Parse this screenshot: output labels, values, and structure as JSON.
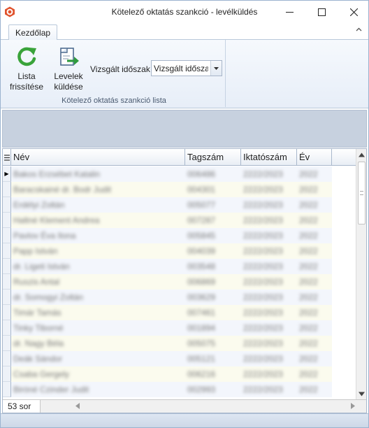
{
  "window": {
    "title": "Kötelező oktatás szankció - levélküldés"
  },
  "ribbon": {
    "tabs": [
      {
        "label": "Kezdőlap",
        "active": true
      }
    ],
    "buttons": {
      "refresh": {
        "line1": "Lista",
        "line2": "frissítése",
        "icon": "refresh-icon"
      },
      "send": {
        "line1": "Levelek",
        "line2": "küldése",
        "icon": "send-letters-icon"
      }
    },
    "period": {
      "label": "Vizsgált időszak",
      "value": "Vizsgált időszak"
    },
    "group_caption": "Kötelező oktatás szankció lista"
  },
  "grid": {
    "columns": [
      "Név",
      "Tagszám",
      "Iktatószám",
      "Év"
    ],
    "rows": [
      {
        "nev": "Bakos Erzsébet Katalin",
        "tagszam": "006486",
        "iktato": "2222/2023",
        "ev": "2022"
      },
      {
        "nev": "Baracskainé dr. Bodr Judit",
        "tagszam": "004301",
        "iktato": "2222/2023",
        "ev": "2022"
      },
      {
        "nev": "Erdélyi Zoltán",
        "tagszam": "005077",
        "iktato": "2222/2023",
        "ev": "2022"
      },
      {
        "nev": "Haltné Klement Andrea",
        "tagszam": "007287",
        "iktato": "2222/2023",
        "ev": "2022"
      },
      {
        "nev": "Pavlov Éva Ilona",
        "tagszam": "005845",
        "iktato": "2222/2023",
        "ev": "2022"
      },
      {
        "nev": "Papp István",
        "tagszam": "004039",
        "iktato": "2222/2023",
        "ev": "2022"
      },
      {
        "nev": "dr. Ligeti István",
        "tagszam": "003548",
        "iktato": "2222/2023",
        "ev": "2022"
      },
      {
        "nev": "Ruszis Antal",
        "tagszam": "006869",
        "iktato": "2222/2023",
        "ev": "2022"
      },
      {
        "nev": "dr. Somogyi Zoltán",
        "tagszam": "003629",
        "iktato": "2222/2023",
        "ev": "2022"
      },
      {
        "nev": "Timár Tamás",
        "tagszam": "007461",
        "iktato": "2222/2023",
        "ev": "2022"
      },
      {
        "nev": "Tinky Tiborné",
        "tagszam": "001894",
        "iktato": "2222/2023",
        "ev": "2022"
      },
      {
        "nev": "dr. Nagy Béla",
        "tagszam": "005075",
        "iktato": "2222/2023",
        "ev": "2022"
      },
      {
        "nev": "Deák Sándor",
        "tagszam": "005121",
        "iktato": "2222/2023",
        "ev": "2022"
      },
      {
        "nev": "Csaba Gergely",
        "tagszam": "006216",
        "iktato": "2222/2023",
        "ev": "2022"
      },
      {
        "nev": "Biróné Czinder Judit",
        "tagszam": "002993",
        "iktato": "2222/2023",
        "ev": "2022"
      }
    ],
    "row_count": "53 sor",
    "current_row_marker": "▶"
  },
  "colors": {
    "row_odd": "#f3f6fc",
    "row_even": "#fbfbee",
    "refresh_green": "#3aa33a",
    "send_green": "#2f9a3e",
    "app_icon": "#e0522c"
  }
}
